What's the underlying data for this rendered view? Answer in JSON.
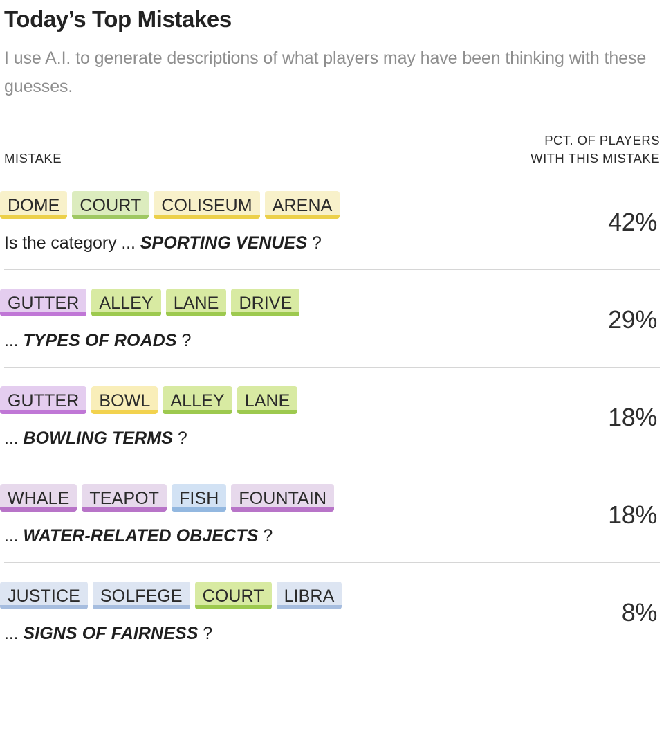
{
  "header": {
    "title": "Today’s Top Mistakes",
    "subtitle": "I use A.I. to generate descriptions of what players may have been thinking with these guesses."
  },
  "table": {
    "columns": {
      "mistake": "MISTAKE",
      "pct_line1": "PCT. OF PLAYERS",
      "pct_line2": "WITH THIS MISTAKE"
    },
    "rows": [
      {
        "tiles": [
          {
            "label": "DOME",
            "color": "yellow"
          },
          {
            "label": "COURT",
            "color": "green"
          },
          {
            "label": "COLISEUM",
            "color": "yellow"
          },
          {
            "label": "ARENA",
            "color": "yellow"
          }
        ],
        "caption_prefix": "Is the category ...",
        "category": "SPORTING VENUES",
        "caption_suffix": "?",
        "pct": "42%"
      },
      {
        "tiles": [
          {
            "label": "GUTTER",
            "color": "purple"
          },
          {
            "label": "ALLEY",
            "color": "green-strong"
          },
          {
            "label": "LANE",
            "color": "green-strong"
          },
          {
            "label": "DRIVE",
            "color": "green-strong"
          }
        ],
        "caption_prefix": "...",
        "category": "TYPES OF ROADS",
        "caption_suffix": "?",
        "pct": "29%"
      },
      {
        "tiles": [
          {
            "label": "GUTTER",
            "color": "purple"
          },
          {
            "label": "BOWL",
            "color": "yellow-strong"
          },
          {
            "label": "ALLEY",
            "color": "green-strong"
          },
          {
            "label": "LANE",
            "color": "green-strong"
          }
        ],
        "caption_prefix": "...",
        "category": "BOWLING TERMS",
        "caption_suffix": "?",
        "pct": "18%"
      },
      {
        "tiles": [
          {
            "label": "WHALE",
            "color": "purple-soft"
          },
          {
            "label": "TEAPOT",
            "color": "purple-soft"
          },
          {
            "label": "FISH",
            "color": "blue"
          },
          {
            "label": "FOUNTAIN",
            "color": "purple-soft"
          }
        ],
        "caption_prefix": "...",
        "category": "WATER-RELATED OBJECTS",
        "caption_suffix": "?",
        "pct": "18%"
      },
      {
        "tiles": [
          {
            "label": "JUSTICE",
            "color": "blue-soft"
          },
          {
            "label": "SOLFEGE",
            "color": "blue-soft"
          },
          {
            "label": "COURT",
            "color": "green-strong"
          },
          {
            "label": "LIBRA",
            "color": "blue-soft"
          }
        ],
        "caption_prefix": "...",
        "category": "SIGNS OF FAIRNESS",
        "caption_suffix": "?",
        "pct": "8%"
      }
    ]
  },
  "chart_data": {
    "type": "table",
    "title": "Today’s Top Mistakes",
    "subtitle": "I use A.I. to generate descriptions of what players may have been thinking with these guesses.",
    "columns": [
      "MISTAKE",
      "PCT. OF PLAYERS WITH THIS MISTAKE"
    ],
    "categories": [
      "SPORTING VENUES",
      "TYPES OF ROADS",
      "BOWLING TERMS",
      "WATER-RELATED OBJECTS",
      "SIGNS OF FAIRNESS"
    ],
    "values": [
      42,
      29,
      18,
      18,
      8
    ],
    "ylabel": "Pct. of players with this mistake",
    "xlabel": "",
    "guesses": [
      [
        "DOME",
        "COURT",
        "COLISEUM",
        "ARENA"
      ],
      [
        "GUTTER",
        "ALLEY",
        "LANE",
        "DRIVE"
      ],
      [
        "GUTTER",
        "BOWL",
        "ALLEY",
        "LANE"
      ],
      [
        "WHALE",
        "TEAPOT",
        "FISH",
        "FOUNTAIN"
      ],
      [
        "JUSTICE",
        "SOLFEGE",
        "COURT",
        "LIBRA"
      ]
    ],
    "swatch_colors": {
      "yellow": "#f8f1ca",
      "yellow_bar": "#ecd04a",
      "yellow_strong": "#f9eeb9",
      "yellow_strong_bar": "#f2d24e",
      "green": "#dcecbe",
      "green_bar": "#9fc862",
      "green_strong": "#d8eaa2",
      "green_strong_bar": "#9dc94f",
      "purple": "#e4cdef",
      "purple_bar": "#c077d6",
      "purple_soft": "#e7d9ec",
      "purple_soft_bar": "#b874c8",
      "blue": "#d2e2f4",
      "blue_bar": "#93b8e0",
      "blue_soft": "#dde5f2",
      "blue_soft_bar": "#a6bddf"
    }
  }
}
